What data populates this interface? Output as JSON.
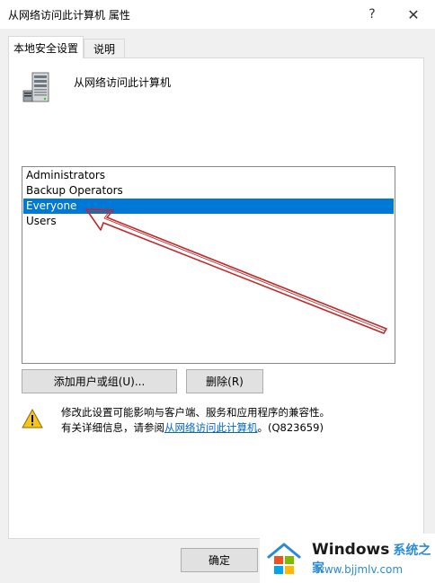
{
  "window": {
    "title": "从网络访问此计算机 属性",
    "help_symbol": "?",
    "close_symbol": "✕"
  },
  "tabs": [
    {
      "label": "本地安全设置",
      "active": true
    },
    {
      "label": "说明",
      "active": false
    }
  ],
  "policy": {
    "icon": "server-icon",
    "title": "从网络访问此计算机"
  },
  "members": {
    "items": [
      {
        "label": "Administrators",
        "selected": false
      },
      {
        "label": "Backup Operators",
        "selected": false
      },
      {
        "label": "Everyone",
        "selected": true
      },
      {
        "label": "Users",
        "selected": false
      }
    ],
    "selection_color": "#0078d7"
  },
  "buttons": {
    "add_label": "添加用户或组(U)...",
    "remove_label": "删除(R)",
    "ok_label": "确定"
  },
  "warning": {
    "icon": "warning-icon",
    "line1": "修改此设置可能影响与客户端、服务和应用程序的兼容性。",
    "line2_prefix": "有关详细信息，请参阅",
    "link_text": "从网络访问此计算机",
    "line2_suffix": "。(Q823659)"
  },
  "annotation": {
    "arrow_color": "#c0282a"
  },
  "watermark": {
    "brand": "Windows",
    "brand_cn": "系统之家",
    "url": "www.bjjmlv.com"
  }
}
